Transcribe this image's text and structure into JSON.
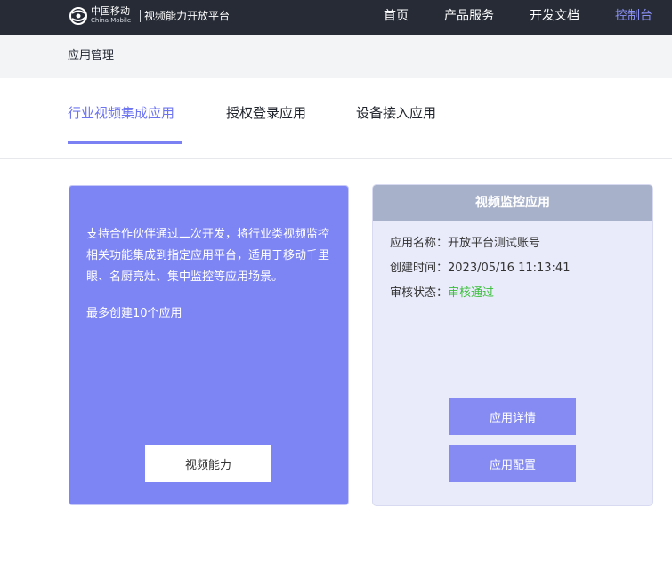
{
  "header": {
    "brand_cn": "中国移动",
    "brand_en": "China Mobile",
    "platform": "视频能力开放平台",
    "nav": [
      {
        "label": "首页"
      },
      {
        "label": "产品服务"
      },
      {
        "label": "开发文档"
      },
      {
        "label": "控制台",
        "active": true
      }
    ],
    "colors": {
      "bar": "#262b35",
      "active": "#8a8ff6"
    }
  },
  "breadcrumb": "应用管理",
  "tabs": [
    {
      "label": "行业视频集成应用",
      "active": true
    },
    {
      "label": "授权登录应用"
    },
    {
      "label": "设备接入应用"
    }
  ],
  "intro_card": {
    "description": "支持合作伙伴通过二次开发，将行业类视频监控相关功能集成到指定应用平台，适用于移动千里眼、名厨亮灶、集中监控等应用场景。",
    "limit": "最多创建10个应用",
    "button": "视频能力",
    "color": "#7d84f3"
  },
  "app_card": {
    "title": "视频监控应用",
    "rows": [
      {
        "label": "应用名称：",
        "value": "开放平台测试账号"
      },
      {
        "label": "创建时间：",
        "value": "2023/05/16 11:13:41"
      },
      {
        "label": "审核状态：",
        "value": "审核通过",
        "status_color": "#3bbf3b"
      }
    ],
    "buttons": {
      "detail": "应用详情",
      "config": "应用配置"
    }
  }
}
